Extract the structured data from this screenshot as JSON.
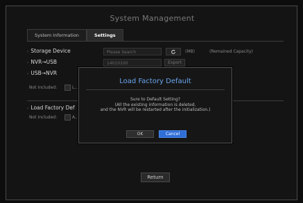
{
  "window": {
    "title": "System Management"
  },
  "tabs": [
    {
      "label": "System Information"
    },
    {
      "label": "Settings"
    }
  ],
  "storage": {
    "label": "Storage Device",
    "select_value": "Please Search",
    "unit": "(MB)",
    "capacity_label": "(Remained Capacity)"
  },
  "nvr_usb": {
    "label": "NVR→USB",
    "value": "14010100",
    "export_label": "Export"
  },
  "usb_nvr": {
    "label": "USB→NVR"
  },
  "not_included_1": {
    "label": "Not Included:",
    "option": "L..."
  },
  "factory": {
    "label": "Load Factory Def",
    "not_included_label": "Not Included:",
    "option": "A..."
  },
  "footer": {
    "return_label": "Return"
  },
  "dialog": {
    "title": "Load Factory Default",
    "line1": "Sure to Default Setting?",
    "line2": "(All the existing information is deleted,",
    "line3": "and the NVR will be restarted after the initialization.)",
    "ok_label": "OK",
    "cancel_label": "Cancel"
  },
  "colors": {
    "accent": "#2f6fd6",
    "title_accent": "#6aa6f0"
  },
  "icons": {
    "refresh": "refresh-icon"
  }
}
